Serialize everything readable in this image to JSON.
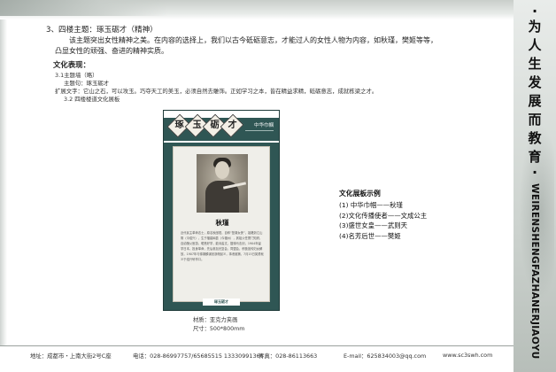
{
  "section": {
    "heading": "3、四楼主题：琢玉砺才（精神）",
    "para1": "该主题突出女性精神之美。在内容的选择上，我们以古今砥砺意志，才能过人的女性人物为内容，如秋瑾，樊姬等等，",
    "para2": "凸显女性的顽强、奋进的精神实质。",
    "sub_heading": "文化表现：",
    "s1": "3.1主题墙（略）",
    "s2": "主题句：琢玉砺才",
    "s3": "扩展文字：它山之石，可以攻玉。巧夺天工的美玉，必须自然去雕饰。正如学习之本，皆在精益求精，砥砺意志，成就栋梁之才。",
    "s4": "3.2 四楼楼道文化展板"
  },
  "board": {
    "logo_chars": [
      "琢",
      "玉",
      "砺",
      "才"
    ],
    "brand": "中华巾帼",
    "name": "秋瑾",
    "bio": "近代民主革命志士，原名秋闺瑾，自称“鉴湖女侠”，祖籍浙江山阴（今绍兴），生于福建闽县（今福州），其祖父任厦门知府，自幼随父宦游，聪慧好学，能诗善文，擅骑马击剑，1904年留学日本，投身革命，先后参加光复会、同盟会，积极宣传妇女解放，1907年与徐锡麟谋划浙皖起义，事泄被捕，7月15日英勇就义于绍兴轩亭口。",
    "footer": "琢玉砺才"
  },
  "material": {
    "line1": "材质：亚克力夹画",
    "line2": "尺寸：500*800mm"
  },
  "example": {
    "title": "文化展板示例",
    "items": [
      "(1) 中华巾帼——秋瑾",
      "(2)文化传播使者——文成公主",
      "(3)盛世女皇——武则天",
      "(4)名芳后世——樊姬"
    ]
  },
  "slogan": {
    "chars": [
      "为",
      "人",
      "生",
      "发",
      "展",
      "而",
      "教",
      "育"
    ],
    "dot": "·",
    "english": "WEIRENSHENGFAZHANERJIAOYU"
  },
  "footer": {
    "address": "地址：成都市・上南大街2号C座",
    "phone": "电话：028-86997757/65685515  13330991366",
    "fax": "传真：028-86113663",
    "email": "E-mail：625834003@qq.com",
    "web": "www.sc3swh.com"
  },
  "colors": {
    "board_teal": "#2f5654",
    "panel_grey": "#cdd3cf"
  }
}
